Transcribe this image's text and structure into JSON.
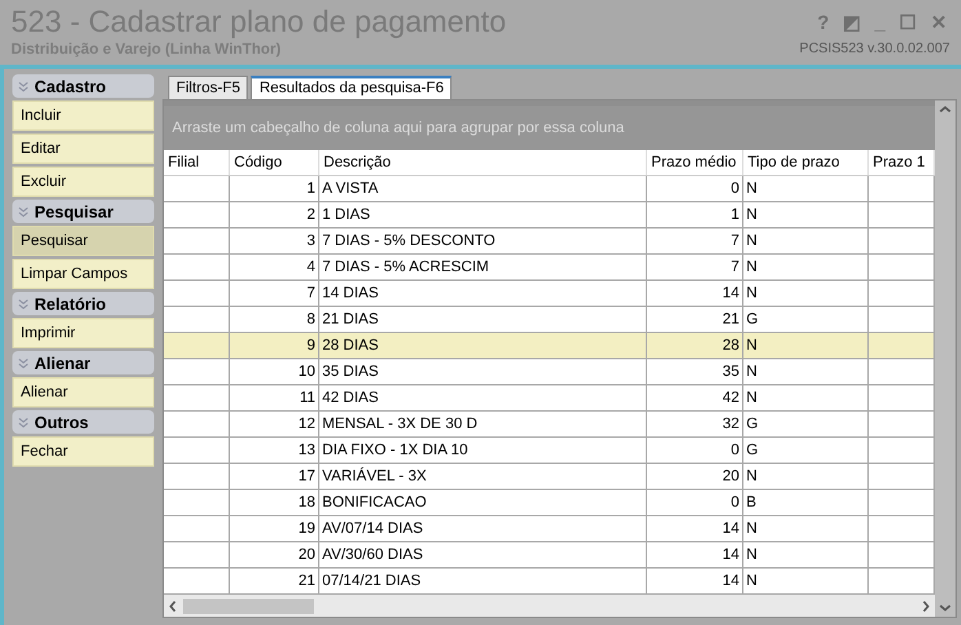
{
  "window": {
    "title": "523 - Cadastrar plano de pagamento",
    "subtitle": "Distribuição e Varejo (Linha WinThor)",
    "version": "PCSIS523  v.30.0.02.007",
    "controls": [
      "?",
      "◩",
      "_",
      "☐",
      "✕"
    ]
  },
  "sidebar": [
    {
      "title": "Cadastro",
      "items": [
        {
          "label": "Incluir",
          "selected": false
        },
        {
          "label": "Editar",
          "selected": false
        },
        {
          "label": "Excluir",
          "selected": false
        }
      ]
    },
    {
      "title": "Pesquisar",
      "items": [
        {
          "label": "Pesquisar",
          "selected": true
        },
        {
          "label": "Limpar Campos",
          "selected": false
        }
      ]
    },
    {
      "title": "Relatório",
      "items": [
        {
          "label": "Imprimir",
          "selected": false
        }
      ]
    },
    {
      "title": "Alienar",
      "items": [
        {
          "label": "Alienar",
          "selected": false
        }
      ]
    },
    {
      "title": "Outros",
      "items": [
        {
          "label": "Fechar",
          "selected": false
        }
      ]
    }
  ],
  "tabs": [
    {
      "label": "Filtros-F5",
      "selected": false
    },
    {
      "label": "Resultados da pesquisa-F6",
      "selected": true
    }
  ],
  "group_panel": "Arraste um cabeçalho de coluna aqui para agrupar por essa coluna",
  "table": {
    "columns": [
      "Filial",
      "Código",
      "Descrição",
      "Prazo médio",
      "Tipo de prazo",
      "Prazo 1"
    ],
    "rows": [
      {
        "codigo": "1",
        "descricao": "A VISTA",
        "prazo_medio": "0",
        "tipo": "N",
        "selected": false
      },
      {
        "codigo": "2",
        "descricao": "1 DIAS",
        "prazo_medio": "1",
        "tipo": "N",
        "selected": false
      },
      {
        "codigo": "3",
        "descricao": "7 DIAS - 5% DESCONTO",
        "prazo_medio": "7",
        "tipo": "N",
        "selected": false
      },
      {
        "codigo": "4",
        "descricao": "7 DIAS - 5% ACRESCIM",
        "prazo_medio": "7",
        "tipo": "N",
        "selected": false
      },
      {
        "codigo": "7",
        "descricao": "14 DIAS",
        "prazo_medio": "14",
        "tipo": "N",
        "selected": false
      },
      {
        "codigo": "8",
        "descricao": "21 DIAS",
        "prazo_medio": "21",
        "tipo": "G",
        "selected": false
      },
      {
        "codigo": "9",
        "descricao": "28 DIAS",
        "prazo_medio": "28",
        "tipo": "N",
        "selected": true
      },
      {
        "codigo": "10",
        "descricao": "35 DIAS",
        "prazo_medio": "35",
        "tipo": "N",
        "selected": false
      },
      {
        "codigo": "11",
        "descricao": "42 DIAS",
        "prazo_medio": "42",
        "tipo": "N",
        "selected": false
      },
      {
        "codigo": "12",
        "descricao": "MENSAL - 3X  DE 30 D",
        "prazo_medio": "32",
        "tipo": "G",
        "selected": false
      },
      {
        "codigo": "13",
        "descricao": "DIA FIXO - 1X DIA 10",
        "prazo_medio": "0",
        "tipo": "G",
        "selected": false
      },
      {
        "codigo": "17",
        "descricao": "VARIÁVEL - 3X",
        "prazo_medio": "20",
        "tipo": "N",
        "selected": false
      },
      {
        "codigo": "18",
        "descricao": "BONIFICACAO",
        "prazo_medio": "0",
        "tipo": "B",
        "selected": false
      },
      {
        "codigo": "19",
        "descricao": "AV/07/14 DIAS",
        "prazo_medio": "14",
        "tipo": "N",
        "selected": false
      },
      {
        "codigo": "20",
        "descricao": "AV/30/60 DIAS",
        "prazo_medio": "14",
        "tipo": "N",
        "selected": false
      },
      {
        "codigo": "21",
        "descricao": "07/14/21 DIAS",
        "prazo_medio": "14",
        "tipo": "N",
        "selected": false
      }
    ]
  }
}
